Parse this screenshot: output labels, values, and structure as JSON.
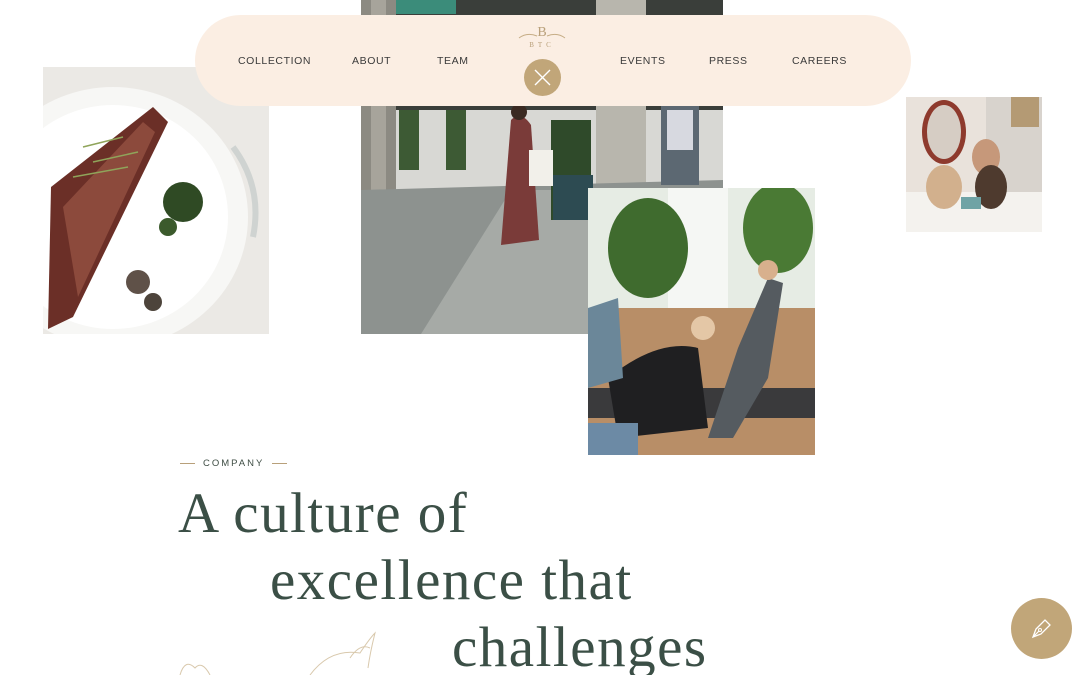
{
  "nav": {
    "items": [
      "COLLECTION",
      "ABOUT",
      "TEAM",
      "EVENTS",
      "PRESS",
      "CAREERS"
    ],
    "logo_letter": "B",
    "logo_sub": "BTC",
    "close_icon": "close-icon"
  },
  "section": {
    "label": "COMPANY",
    "headline_lines": [
      "A culture of",
      "excellence that",
      "challenges"
    ]
  },
  "floating_button_icon": "pen-icon",
  "colors": {
    "nav_bg": "#fbeee3",
    "accent_gold": "#c1a679",
    "headline": "#3b4f46"
  }
}
